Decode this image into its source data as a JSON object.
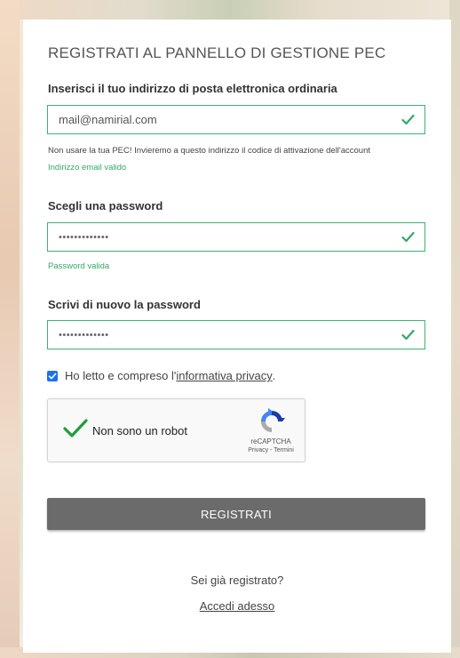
{
  "form": {
    "title": "REGISTRATI AL PANNELLO DI GESTIONE PEC",
    "email": {
      "label": "Inserisci il tuo indirizzo di posta elettronica ordinaria",
      "value": "mail@namirial.com",
      "hint": "Non usare la tua PEC! Invieremo a questo indirizzo il codice di attivazione dell'account",
      "status": "Indirizzo email valido"
    },
    "password": {
      "label": "Scegli una password",
      "value": "•••••••••••••",
      "status": "Password valida"
    },
    "password_confirm": {
      "label": "Scrivi di nuovo la password",
      "value": "•••••••••••••"
    },
    "privacy": {
      "text_before": "Ho letto e compreso l'",
      "link_text": "informativa privacy",
      "text_after": ".",
      "checked": true
    },
    "captcha": {
      "label": "Non sono un robot",
      "brand": "reCAPTCHA",
      "links": "Privacy - Termini"
    },
    "submit_label": "REGISTRATI",
    "already_registered": "Sei già registrato?",
    "login_link": "Accedi adesso"
  },
  "colors": {
    "valid_green": "#33a867",
    "button_gray": "#6b6b6b",
    "checkbox_blue": "#1a73e8"
  }
}
